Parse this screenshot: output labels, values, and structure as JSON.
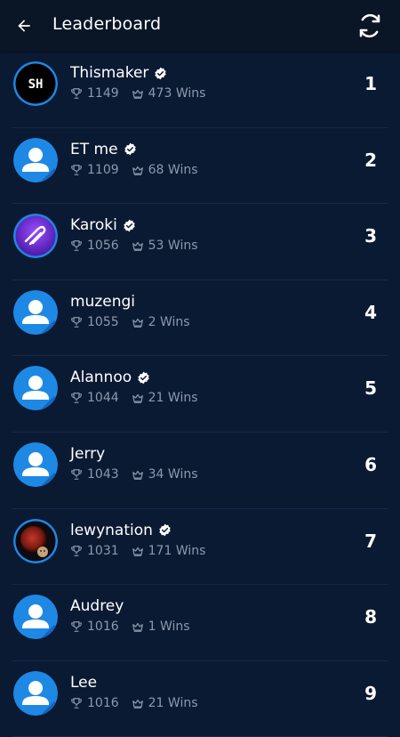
{
  "header": {
    "title": "Leaderboard",
    "back_icon": "arrow-left-icon",
    "refresh_icon": "refresh-icon"
  },
  "colors": {
    "background": "#0b1a33",
    "appbar": "#0a1526",
    "avatar_default": "#1e88e5",
    "stat_text": "#8c99ad"
  },
  "players": [
    {
      "name": "Thismaker",
      "verified": true,
      "trophies": "1149",
      "wins": "473 Wins",
      "rank": "1",
      "avatar": "sh-logo"
    },
    {
      "name": "ET me",
      "verified": true,
      "trophies": "1109",
      "wins": "68 Wins",
      "rank": "2",
      "avatar": "default"
    },
    {
      "name": "Karoki",
      "verified": true,
      "trophies": "1056",
      "wins": "53 Wins",
      "rank": "3",
      "avatar": "purple-logo"
    },
    {
      "name": "muzengi",
      "verified": false,
      "trophies": "1055",
      "wins": "2 Wins",
      "rank": "4",
      "avatar": "default"
    },
    {
      "name": "Alannoo",
      "verified": true,
      "trophies": "1044",
      "wins": "21 Wins",
      "rank": "5",
      "avatar": "default"
    },
    {
      "name": "Jerry",
      "verified": false,
      "trophies": "1043",
      "wins": "34 Wins",
      "rank": "6",
      "avatar": "default"
    },
    {
      "name": "lewynation",
      "verified": true,
      "trophies": "1031",
      "wins": "171 Wins",
      "rank": "7",
      "avatar": "photo"
    },
    {
      "name": "Audrey",
      "verified": false,
      "trophies": "1016",
      "wins": "1 Wins",
      "rank": "8",
      "avatar": "default"
    },
    {
      "name": "Lee",
      "verified": false,
      "trophies": "1016",
      "wins": "21 Wins",
      "rank": "9",
      "avatar": "default"
    }
  ],
  "sh_logo_text": "SH"
}
